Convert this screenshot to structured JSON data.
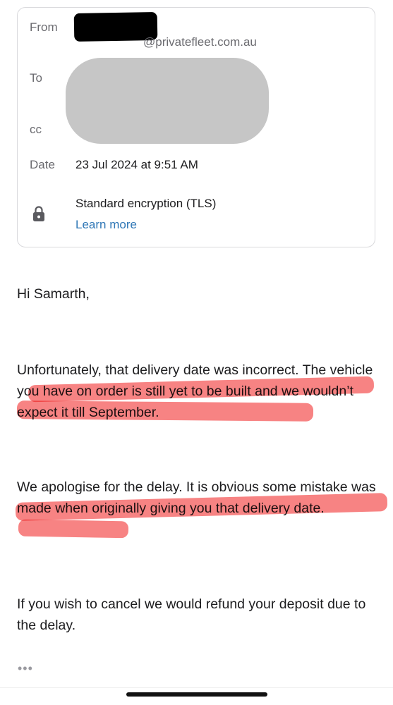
{
  "header": {
    "from_label": "From",
    "from_domain": "@privatefleet.com.au",
    "to_label": "To",
    "cc_label": "cc",
    "date_label": "Date",
    "date_value": "23 Jul 2024 at 9:51 AM",
    "encryption_text": "Standard encryption (TLS)",
    "learn_more": "Learn more",
    "lock_icon": "lock-icon"
  },
  "body": {
    "greeting": "Hi Samarth,",
    "paragraphs": [
      "Unfortunately, that delivery date was incorrect. The vehicle you have on order is still yet to be built and we wouldn’t expect it till September.",
      "We apologise for the delay. It is obvious some mistake was made when originally giving you that delivery date.",
      "If you wish to cancel we would refund your deposit due to the delay."
    ],
    "more_indicator": "•••"
  },
  "colors": {
    "highlight": "#f45353",
    "link": "#2f77b6",
    "redaction_gray": "#c6c6c6",
    "redaction_black": "#000000"
  }
}
